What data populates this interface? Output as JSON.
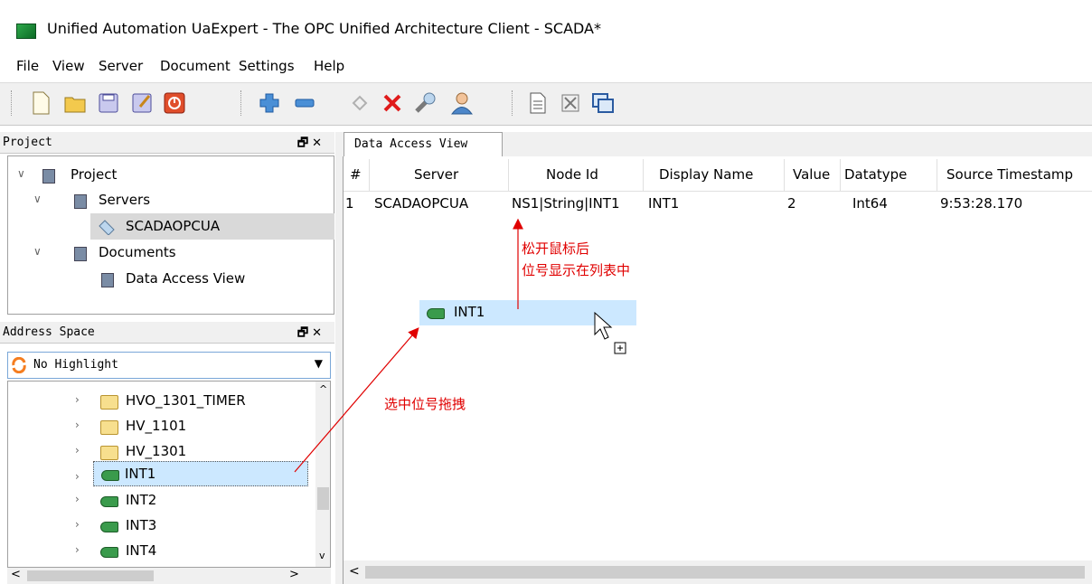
{
  "window": {
    "title": "Unified Automation UaExpert - The OPC Unified Architecture Client - SCADA*"
  },
  "menu": [
    "File",
    "View",
    "Server",
    "Document",
    "Settings",
    "Help"
  ],
  "toolbar": {
    "icons": [
      "new-document-icon",
      "open-folder-icon",
      "save-icon",
      "save-as-icon",
      "quit-icon",
      "add-server-icon",
      "remove-server-icon",
      "connect-icon",
      "disconnect-icon",
      "settings-icon",
      "user-icon",
      "report-icon",
      "clear-icon",
      "window-icon"
    ]
  },
  "project_pane": {
    "title": "Project",
    "tree": {
      "root": "Project",
      "servers": "Servers",
      "server_item": "SCADAOPCUA",
      "documents": "Documents",
      "document_item": "Data Access View"
    }
  },
  "address_pane": {
    "title": "Address Space",
    "highlight": "No Highlight",
    "items": [
      "HVO_1301_TIMER",
      "HV_1101",
      "HV_1301",
      "INT1",
      "INT2",
      "INT3",
      "INT4"
    ]
  },
  "data_view": {
    "tab": "Data Access View",
    "columns": [
      "#",
      "Server",
      "Node Id",
      "Display Name",
      "Value",
      "Datatype",
      "Source Timestamp"
    ],
    "rows": [
      {
        "num": "1",
        "server": "SCADAOPCUA",
        "node_id": "NS1|String|INT1",
        "display_name": "INT1",
        "value": "2",
        "datatype": "Int64",
        "timestamp": "9:53:28.170"
      }
    ]
  },
  "drag": {
    "label": "INT1"
  },
  "annotations": {
    "release_line1": "松开鼠标后",
    "release_line2": "位号显示在列表中",
    "drag_hint": "选中位号拖拽"
  },
  "colors": {
    "selection": "#cce8ff",
    "annotation": "#e00000",
    "tag_green": "#3a9b4c"
  }
}
